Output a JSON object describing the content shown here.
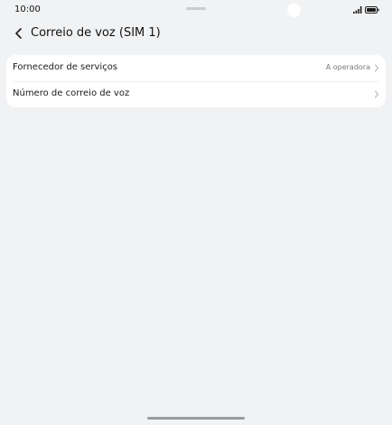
{
  "status_bar": {
    "time": "10:00",
    "signal_icon": "signal-icon",
    "battery_icon": "battery-icon"
  },
  "header": {
    "back_icon": "back-arrow-icon",
    "title": "Correio de voz (SIM 1)"
  },
  "settings": {
    "items": [
      {
        "label": "Fornecedor de serviços",
        "value": "A operadora",
        "icon": "chevron-right-icon"
      },
      {
        "label": "Número de correio de voz",
        "value": "",
        "icon": "chevron-right-icon"
      }
    ]
  },
  "colors": {
    "background": "#f1f2f4",
    "card": "#ffffff",
    "secondary_text": "#7a7b7e"
  }
}
